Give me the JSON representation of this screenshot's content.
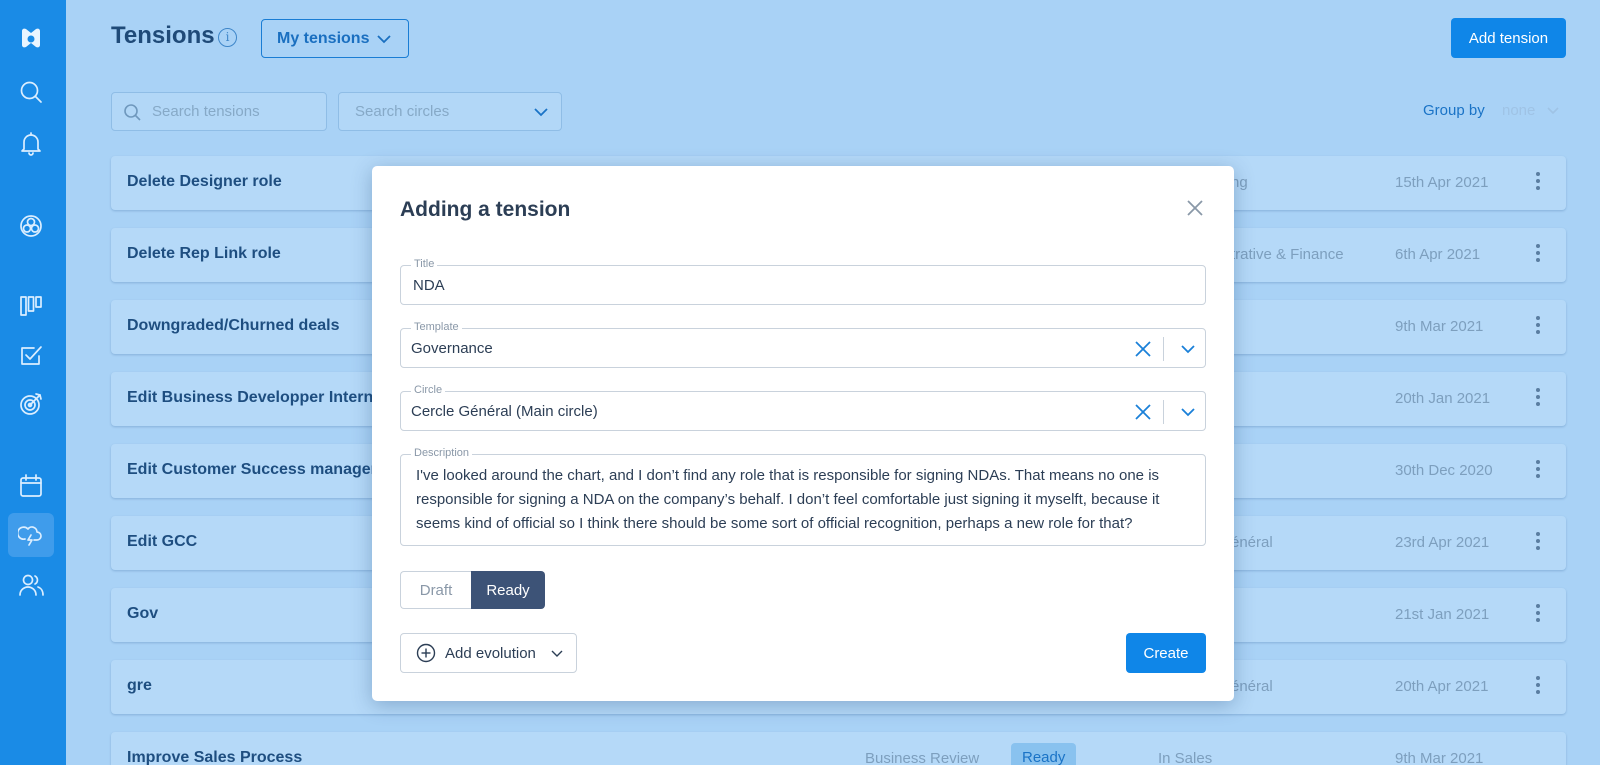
{
  "header": {
    "title": "Tensions",
    "info_icon": "info-icon",
    "filter_label": "My tensions",
    "add_label": "Add tension"
  },
  "search": {
    "tensions_placeholder": "Search tensions",
    "circles_placeholder": "Search circles",
    "group_by_label": "Group by",
    "group_by_value": "none"
  },
  "sidebar": {
    "items": [
      {
        "icon": "logo-icon"
      },
      {
        "icon": "search-icon"
      },
      {
        "icon": "bell-icon"
      },
      {
        "icon": "circles-icon"
      },
      {
        "icon": "board-icon"
      },
      {
        "icon": "checkbox-icon"
      },
      {
        "icon": "target-icon"
      },
      {
        "icon": "calendar-icon"
      },
      {
        "icon": "tensions-icon",
        "active": true
      },
      {
        "icon": "users-icon"
      }
    ]
  },
  "rows": [
    {
      "title": "Delete Designer role",
      "circle": "ng",
      "date": "15th Apr 2021"
    },
    {
      "title": "Delete Rep Link role",
      "circle": "trative & Finance",
      "date": "6th Apr 2021"
    },
    {
      "title": "Downgraded/Churned deals",
      "circle": "",
      "date": "9th Mar 2021"
    },
    {
      "title": "Edit Business Developper Internatio",
      "circle": "",
      "date": "20th Jan 2021"
    },
    {
      "title": "Edit Customer Success manager rol",
      "circle": "",
      "date": "30th Dec 2020"
    },
    {
      "title": "Edit GCC",
      "circle": "énéral",
      "date": "23rd Apr 2021"
    },
    {
      "title": "Gov",
      "circle": "",
      "date": "21st Jan 2021"
    },
    {
      "title": "gre",
      "circle": "énéral",
      "date": "20th Apr 2021"
    },
    {
      "title": "Improve Sales Process",
      "type": "Business Review",
      "status": "Ready",
      "circle": "In Sales",
      "date": "9th Mar 2021"
    }
  ],
  "modal": {
    "title": "Adding a tension",
    "title_field": {
      "label": "Title",
      "value": "NDA"
    },
    "template_field": {
      "label": "Template",
      "value": "Governance"
    },
    "circle_field": {
      "label": "Circle",
      "value": "Cercle Général (Main circle)"
    },
    "description_field": {
      "label": "Description",
      "value": "I've looked around the chart, and I don’t find any role that is responsible for signing NDAs. That means no one is responsible for signing a NDA on the company’s behalf. I don’t feel comfortable just signing it myselft, because it seems kind of official so I think there should be some sort of official recognition, perhaps a new role for that?"
    },
    "status_draft": "Draft",
    "status_ready": "Ready",
    "add_evolution": "Add evolution",
    "create_label": "Create"
  },
  "colors": {
    "sidebar": "#1a8be6",
    "background": "#a9d2f6",
    "primary_button": "#0f86e8",
    "ready_toggle": "#3d5377"
  }
}
